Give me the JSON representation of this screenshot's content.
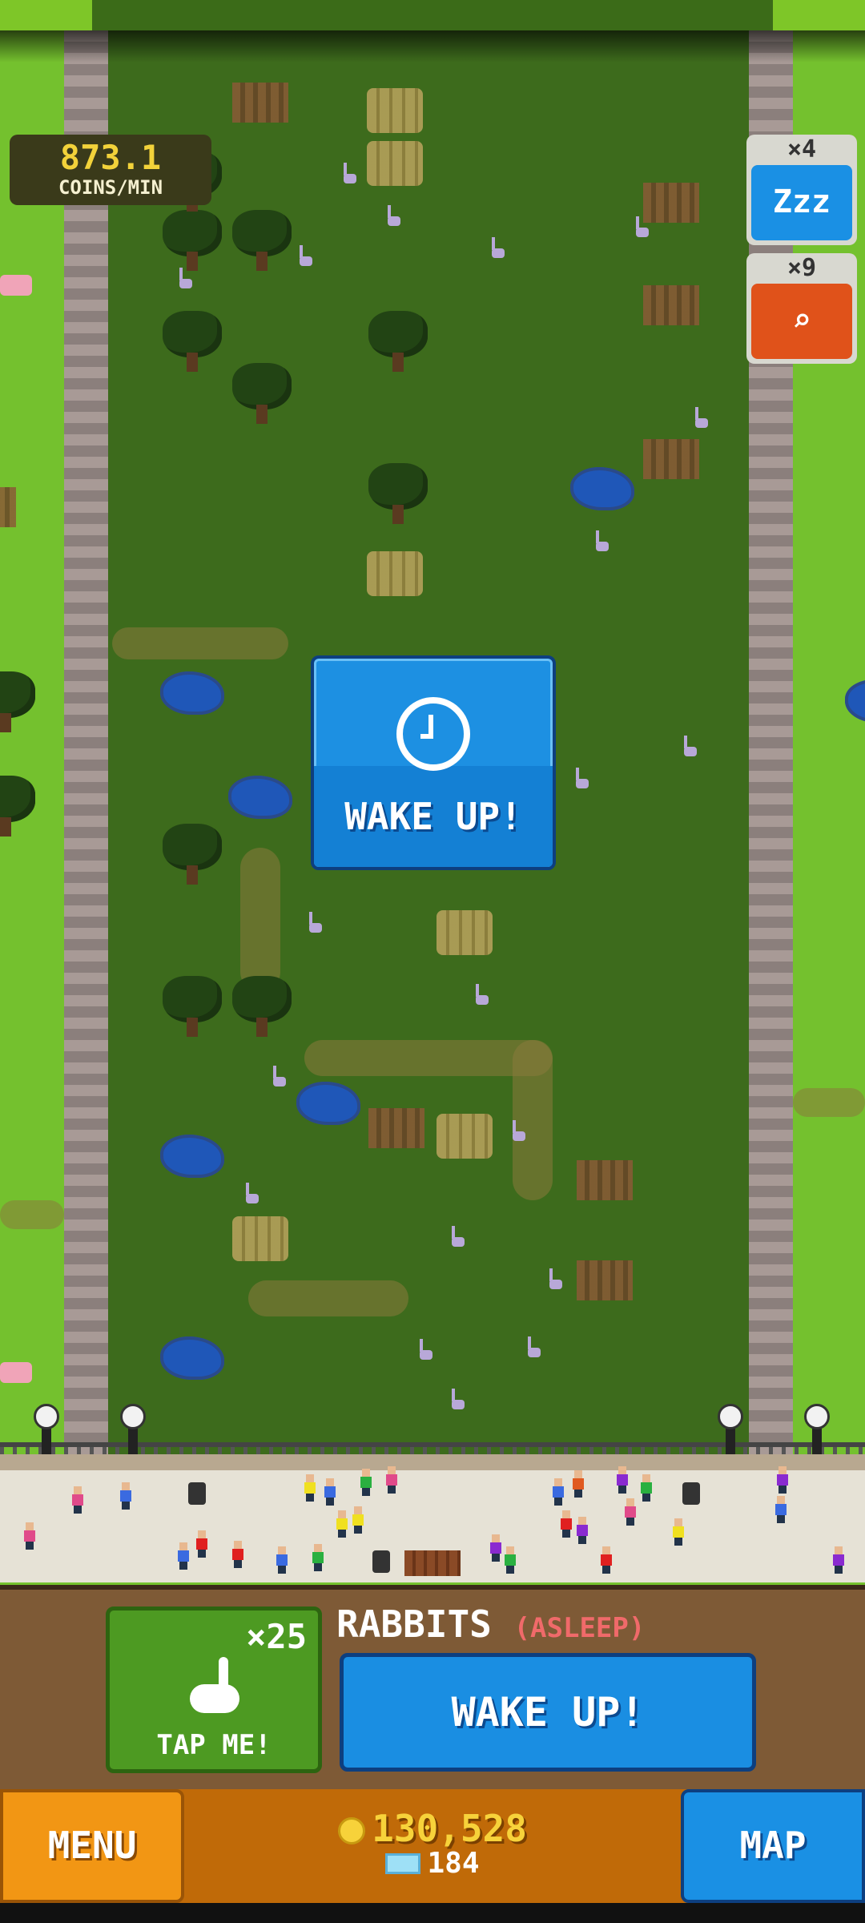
{
  "stats": {
    "coins_per_min_value": "873.1",
    "coins_per_min_unit": "COINS/MIN"
  },
  "powerups": [
    {
      "count": "×4",
      "icon": "z-z-z-icon",
      "glyph": "Zzz",
      "color": "#1a90e4"
    },
    {
      "count": "×9",
      "icon": "magnifier-icon",
      "glyph": "⌕",
      "color": "#e0521a"
    }
  ],
  "wake_panel": {
    "icon": "alarm-clock-icon",
    "label": "WAKE UP!"
  },
  "animal": {
    "count": "×25",
    "icon": "rabbit-icon",
    "tap_label": "TAP ME!",
    "name": "RABBITS",
    "status": "(ASLEEP)",
    "wake_label": "WAKE UP!"
  },
  "nav": {
    "menu_label": "MENU",
    "map_label": "MAP",
    "coins": "130,528",
    "gems": "184",
    "coin_icon": "coin-icon",
    "gem_icon": "gem-icon"
  }
}
